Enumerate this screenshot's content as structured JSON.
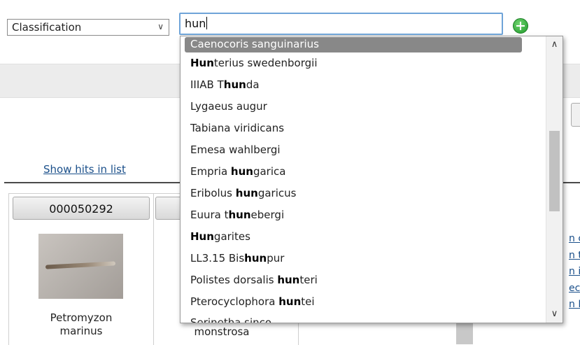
{
  "classification_select": {
    "value": "Classification"
  },
  "search": {
    "value": "hun"
  },
  "add_icon": "plus-circle-icon",
  "show_hits_link": "Show hits in list",
  "cards": [
    {
      "id": "000050292",
      "name_line1": "Petromyzon",
      "name_line2": "marinus"
    },
    {
      "name_line2": "monstrosa"
    }
  ],
  "right_link_fragments": [
    "n c",
    "n ty",
    "n in",
    "ect",
    "n D"
  ],
  "suggestions": [
    {
      "pre": "Caenocoris sanguinarius",
      "bold": "",
      "post": ""
    },
    {
      "pre": "",
      "bold": "Hun",
      "post": "terius swedenborgii"
    },
    {
      "pre": "IIIAB T",
      "bold": "hun",
      "post": "da"
    },
    {
      "pre": "Lygaeus augur",
      "bold": "",
      "post": ""
    },
    {
      "pre": "Tabiana viridicans",
      "bold": "",
      "post": ""
    },
    {
      "pre": "Emesa wahlbergi",
      "bold": "",
      "post": ""
    },
    {
      "pre": "Empria ",
      "bold": "hun",
      "post": "garica"
    },
    {
      "pre": "Eribolus ",
      "bold": "hun",
      "post": "garicus"
    },
    {
      "pre": "Euura t",
      "bold": "hun",
      "post": "ebergi"
    },
    {
      "pre": "",
      "bold": "Hun",
      "post": "garites"
    },
    {
      "pre": "LL3.15 Bis",
      "bold": "hun",
      "post": "pur"
    },
    {
      "pre": "Polistes dorsalis ",
      "bold": "hun",
      "post": "teri"
    },
    {
      "pre": "Pterocyclophora ",
      "bold": "hun",
      "post": "tei"
    },
    {
      "pre": "Serinetha sinco",
      "bold": "",
      "post": ""
    }
  ],
  "colors": {
    "focus_border": "#6fa4d8",
    "selected_bg": "#888888",
    "link": "#1a4f8a",
    "add_green": "#1f9a2a"
  }
}
